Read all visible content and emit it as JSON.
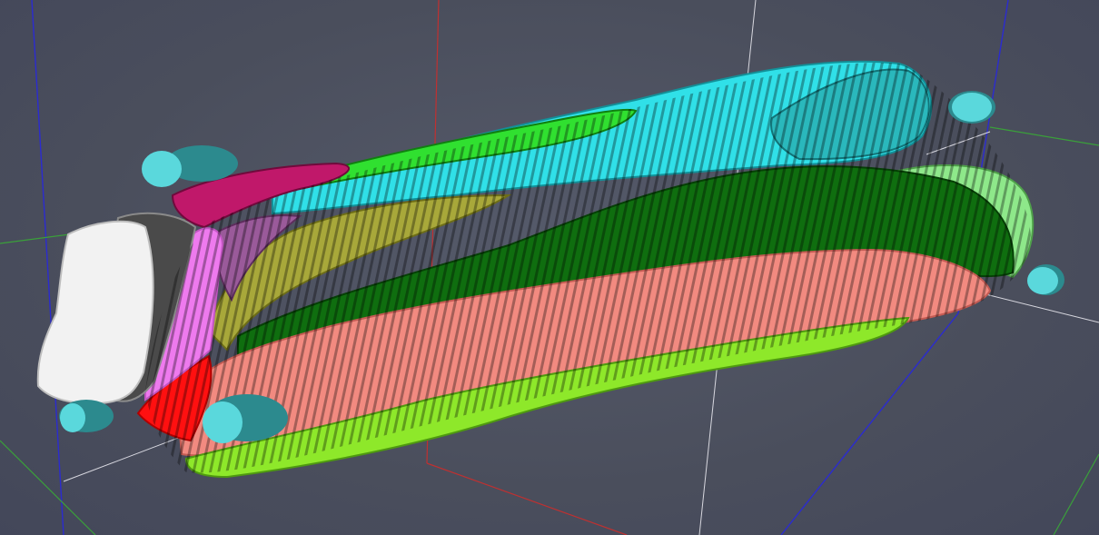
{
  "viewport": {
    "background_color": "#4c5060",
    "axis_colors": {
      "x_axis": "#c03030",
      "y_axis": "#3aa03a",
      "z_axis": "#2b2bd0",
      "bounding_box": "#d8d8e0"
    }
  },
  "segments": [
    {
      "name": "segment-white",
      "color": "#f2f2f2",
      "shade": "#bdbdbd"
    },
    {
      "name": "segment-dark-gray",
      "color": "#4a4a4a",
      "shade": "#8a8a8a"
    },
    {
      "name": "segment-pink",
      "color": "#ee7aee",
      "shade": "#c356c3"
    },
    {
      "name": "segment-red",
      "color": "#ff1010",
      "shade": "#b00000"
    },
    {
      "name": "segment-salmon",
      "color": "#f28a80",
      "shade": "#c45c54"
    },
    {
      "name": "segment-lime",
      "color": "#8ee82a",
      "shade": "#4f9a10"
    },
    {
      "name": "segment-dark-green",
      "color": "#0f6e0f",
      "shade": "#064006"
    },
    {
      "name": "segment-light-green",
      "color": "#8ee88a",
      "shade": "#4fa04a"
    },
    {
      "name": "segment-olive",
      "color": "#a8a83a",
      "shade": "#6e6e18"
    },
    {
      "name": "segment-purple",
      "color": "#9a5a9a",
      "shade": "#5e2e5e"
    },
    {
      "name": "segment-magenta",
      "color": "#c0186a",
      "shade": "#700a3c"
    },
    {
      "name": "segment-bright-green",
      "color": "#30e030",
      "shade": "#108010"
    },
    {
      "name": "segment-cyan",
      "color": "#30e0e8",
      "shade": "#139098"
    },
    {
      "name": "segment-teal",
      "color": "#2ab8bc",
      "shade": "#137478"
    }
  ],
  "markers": {
    "color": "#5ad8dc",
    "shade": "#2c8a8e"
  }
}
